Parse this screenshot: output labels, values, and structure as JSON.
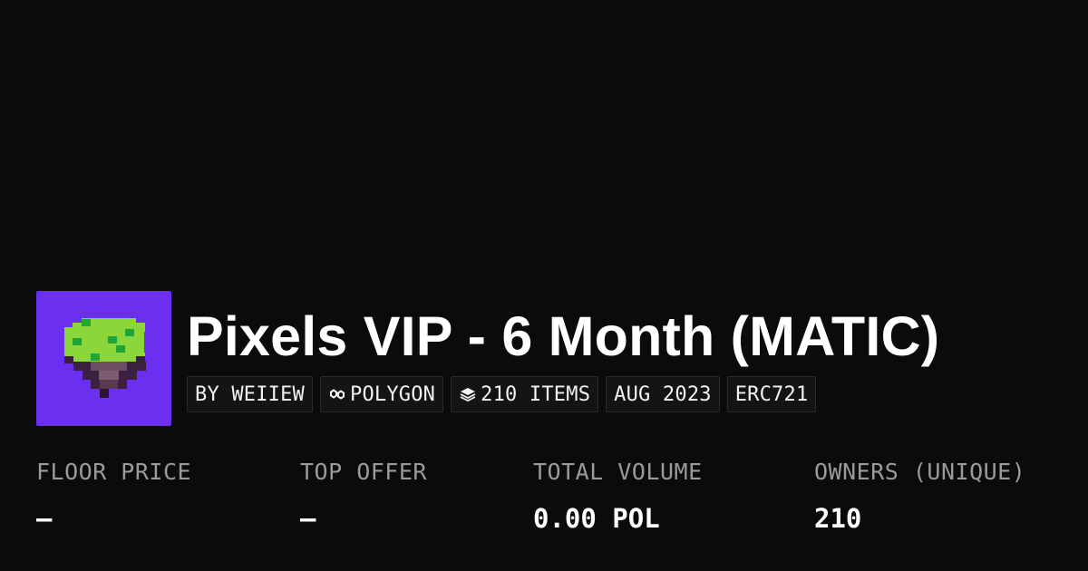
{
  "collection": {
    "title": "Pixels VIP - 6 Month (MATIC)",
    "avatar_icon": "pixel-floating-island-icon",
    "avatar_background": "#6b2ff0"
  },
  "badges": [
    {
      "label": "BY WEIIEW"
    },
    {
      "icon": "polygon-link-icon",
      "label": "POLYGON"
    },
    {
      "icon": "layers-icon",
      "label": "210 ITEMS"
    },
    {
      "label": "AUG 2023"
    },
    {
      "label": "ERC721"
    }
  ],
  "stats": [
    {
      "label": "FLOOR PRICE",
      "value": "–"
    },
    {
      "label": "TOP OFFER",
      "value": "–"
    },
    {
      "label": "TOTAL VOLUME",
      "value": "0.00 POL"
    },
    {
      "label": "OWNERS (UNIQUE)",
      "value": "210"
    }
  ],
  "colors": {
    "background": "#0b0b0b",
    "text": "#ffffff",
    "muted": "#9b9b9b",
    "badge_background": "#141414",
    "badge_border": "#2a2a2a"
  }
}
